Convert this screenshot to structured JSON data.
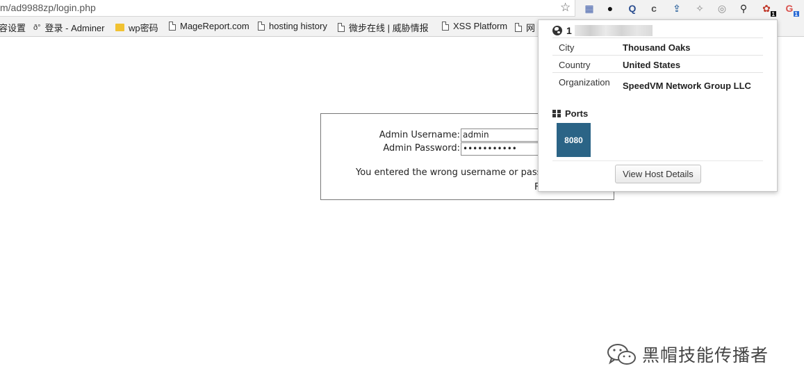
{
  "browser": {
    "url": "m/ad9988zp/login.php",
    "star_icon": "star-icon",
    "extensions": [
      {
        "name": "flag-extension-icon",
        "glyph": "▦",
        "color": "#3b5aa8"
      },
      {
        "name": "mask-extension-icon",
        "glyph": "●",
        "color": "#111111"
      },
      {
        "name": "q-extension-icon",
        "glyph": "Q",
        "color": "#2a4d8f"
      },
      {
        "name": "c-extension-icon",
        "glyph": "c",
        "color": "#555555"
      },
      {
        "name": "uploader-extension-icon",
        "glyph": "⇪",
        "color": "#3c6ea3"
      },
      {
        "name": "satellite-extension-icon",
        "glyph": "✧",
        "color": "#888888"
      },
      {
        "name": "circle-extension-icon",
        "glyph": "◎",
        "color": "#888888"
      },
      {
        "name": "magnifier-extension-icon",
        "glyph": "⚲",
        "color": "#222222"
      },
      {
        "name": "shodan-extension-icon",
        "glyph": "✿",
        "color": "#c0392b",
        "badge": "1"
      },
      {
        "name": "translate-extension-icon",
        "glyph": "G",
        "color": "#d9534f",
        "badge": "1"
      }
    ]
  },
  "bookmarks": [
    {
      "label": "容设置",
      "icon": "none"
    },
    {
      "label": "登录 - Adminer",
      "icon": "adminer"
    },
    {
      "label": "wp密码",
      "icon": "folder"
    },
    {
      "label": "MageReport.com",
      "icon": "page"
    },
    {
      "label": "hosting history",
      "icon": "page"
    },
    {
      "label": "微步在线 | 威胁情报",
      "icon": "page"
    },
    {
      "label": "XSS Platform",
      "icon": "page"
    },
    {
      "label": "网",
      "icon": "page"
    }
  ],
  "login": {
    "username_label": "Admin Username:",
    "username_value": "admin",
    "password_label": "Admin Password:",
    "password_value": "•••••••••••",
    "error_message": "You entered the wrong username or passwo",
    "link_fragment": "F"
  },
  "host_popup": {
    "ip_prefix": "1",
    "rows": [
      {
        "key": "City",
        "value": "Thousand Oaks"
      },
      {
        "key": "Country",
        "value": "United States"
      },
      {
        "key": "Organization",
        "value": "SpeedVM Network Group LLC"
      }
    ],
    "ports_title": "Ports",
    "ports": [
      "8080"
    ],
    "view_button": "View Host Details",
    "port_color": "#2b6486"
  },
  "watermark": {
    "text": "黑帽技能传播者"
  }
}
